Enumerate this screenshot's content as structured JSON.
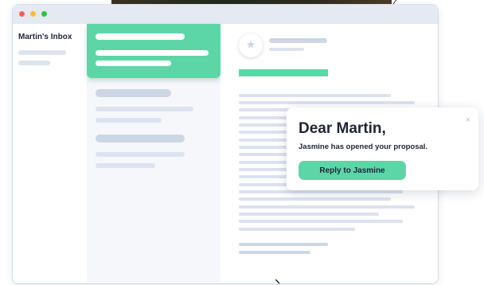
{
  "sidebar": {
    "title": "Martin's Inbox"
  },
  "notification": {
    "title": "Dear Martin,",
    "message": "Jasmine has opened your proposal.",
    "button_label": "Reply to Jasmine",
    "close_glyph": "×"
  },
  "reader": {
    "avatar_icon": "star-icon"
  },
  "window_controls": [
    "close-dot",
    "minimize-dot",
    "maximize-dot"
  ],
  "colors": {
    "accent_green": "#5dd6a7",
    "titlebar": "#e4e9f2",
    "list_background": "#f5f7fb",
    "placeholder": "#dbe2ee",
    "text_dark": "#1e2438",
    "close_red": "#ff5f57",
    "minimize_yellow": "#febc2e",
    "maximize_green": "#28c840"
  }
}
